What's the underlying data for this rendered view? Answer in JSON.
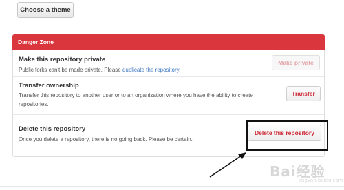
{
  "settings": {
    "theme_button_label": "Choose a theme"
  },
  "danger_zone": {
    "header": "Danger Zone",
    "rows": [
      {
        "title": "Make this repository private",
        "desc_prefix": "Public forks can't be made private. Please ",
        "desc_link": "duplicate the repository",
        "desc_suffix": ".",
        "button": "Make private"
      },
      {
        "title": "Transfer ownership",
        "desc": "Transfer this repository to another user or to an organization where you have the ability to create repositories.",
        "button": "Transfer"
      },
      {
        "title": "Delete this repository",
        "desc": "Once you delete a repository, there is no going back. Please be certain.",
        "button": "Delete this repository"
      }
    ]
  },
  "colors": {
    "danger_header": "#d9363e",
    "danger_text": "#cb2431",
    "link": "#4078c0"
  },
  "watermark": {
    "text": "Bai经验",
    "subtext": "jingyan.baidu.com"
  }
}
